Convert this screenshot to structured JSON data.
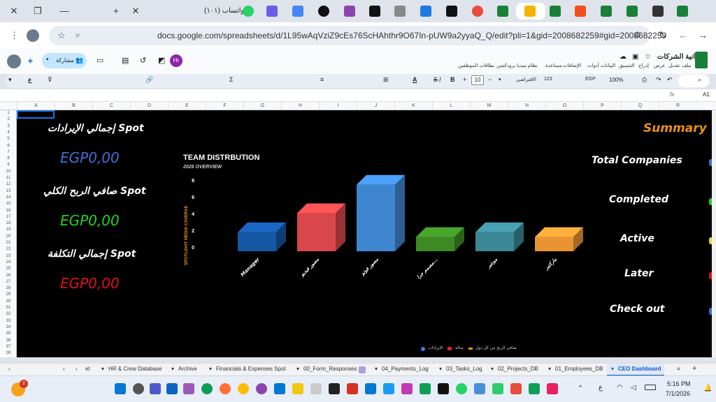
{
  "browser": {
    "tab_active_label": "واتساب (١٠١)",
    "url": "docs.google.com/spreadsheets/d/1L95wAqVziZ9cEs76ScHAhthr9O67In-pUW9a2yyaQ_Q/edit?pli=1&gid=2008682259#gid=2008682259"
  },
  "sheet": {
    "doc_title": "ميزانية الشركات",
    "menus": [
      "ملف",
      "تعديل",
      "عرض",
      "إدراج",
      "التنسيق",
      "البيانات",
      "أدوات",
      "الإضافات",
      "مساعدة",
      "نظام ميديا برودكشن",
      "بطاقات الموظفين"
    ],
    "share_label": "مشاركة",
    "avatar_initials": "Hr",
    "zoom": "100%",
    "currency": "EGP",
    "font_size": "10",
    "font_name": "الافتراضي",
    "cell_ref": "A1",
    "fx": "fx",
    "columns": [
      "A",
      "B",
      "C",
      "D",
      "E",
      "F",
      "G",
      "H",
      "I",
      "J",
      "K",
      "L",
      "M",
      "N",
      "O",
      "P",
      "Q",
      "R"
    ],
    "rows": [
      "1",
      "2",
      "3",
      "4",
      "5",
      "6",
      "7",
      "8",
      "9",
      "10",
      "11",
      "12",
      "13",
      "14",
      "15",
      "16",
      "17",
      "18",
      "19",
      "20",
      "21",
      "22",
      "23",
      "24",
      "25",
      "26",
      "27",
      "28",
      "29",
      "30",
      "31",
      "32",
      "33",
      "34",
      "35",
      "36",
      "37",
      "38"
    ]
  },
  "dashboard": {
    "kpis": [
      {
        "label": "إجمالي الإيرادات Spot",
        "value": "EGP0,00",
        "color": "#3d6fd6"
      },
      {
        "label": "صافي الربح الكلي Spot",
        "value": "EGP0,00",
        "color": "#1ed41e"
      },
      {
        "label": "إجمالي التكلفة Spot",
        "value": "EGP0,00",
        "color": "#e01010"
      }
    ],
    "summary_title": "Summary",
    "summary_color": "#e8901a",
    "summary_items": [
      "Total Companies",
      "Completed",
      "Active",
      "Later",
      "Check out"
    ],
    "bottom_legend": [
      "الإيرادات",
      "سالة",
      "صافي الربح من كل دول"
    ]
  },
  "chart_data": {
    "type": "bar",
    "title": "TEAM DISTRBUTION",
    "subtitle": "2026 OVERVIEW",
    "ylabel": "SPOTLIGHT MEDIA CAVERAE",
    "ylim": [
      0,
      8
    ],
    "yticks": [
      "0",
      "2",
      "4",
      "6",
      "8"
    ],
    "categories": [
      "Manager",
      "مصور فيديو",
      "مصور فوتو",
      "مصمم جرا...",
      "مونتير",
      "ماركتير"
    ],
    "values": [
      2,
      4,
      7,
      1.5,
      2,
      1.5
    ],
    "colors": [
      "#1457a3",
      "#d9474a",
      "#3f86d1",
      "#3d8a24",
      "#3b8796",
      "#ea9333"
    ]
  },
  "sheet_tabs": [
    "et",
    "HR & Crew Database",
    "Archive",
    "Financials & Expenses Spot",
    "00_Form_Responses",
    "04_Payments_Log",
    "03_Tasks_Log",
    "02_Projects_DB",
    "01_Employees_DB",
    "CEO Dashboard"
  ],
  "taskbar": {
    "time": "5:16 PM",
    "date": "7/1/2026",
    "lang": "ع",
    "badge": "2"
  }
}
